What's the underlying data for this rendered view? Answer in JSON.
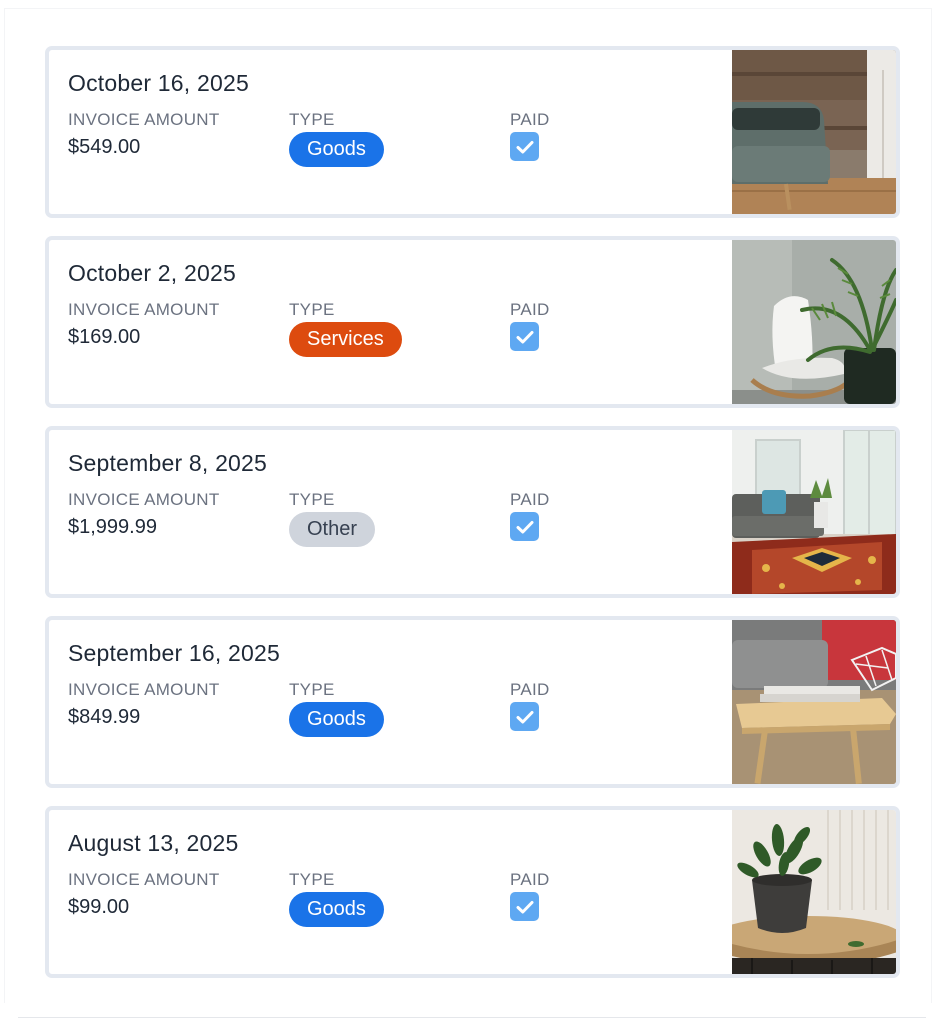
{
  "labels": {
    "amount": "INVOICE AMOUNT",
    "type": "TYPE",
    "paid": "PAID"
  },
  "colors": {
    "goods": "#1a73e8",
    "services": "#dd4b0f",
    "other": "#cfd4dc",
    "checkbox": "#5ea8f2",
    "card_border": "#e3e8f0"
  },
  "invoices": [
    {
      "date": "October 16, 2025",
      "amount": "$549.00",
      "type": "Goods",
      "paid": true,
      "image_icon": "sofa-photo"
    },
    {
      "date": "October 2, 2025",
      "amount": "$169.00",
      "type": "Services",
      "paid": true,
      "image_icon": "chair-plant-photo"
    },
    {
      "date": "September 8, 2025",
      "amount": "$1,999.99",
      "type": "Other",
      "paid": true,
      "image_icon": "living-room-photo"
    },
    {
      "date": "September 16, 2025",
      "amount": "$849.99",
      "type": "Goods",
      "paid": true,
      "image_icon": "coffee-table-photo"
    },
    {
      "date": "August 13, 2025",
      "amount": "$99.00",
      "type": "Goods",
      "paid": true,
      "image_icon": "potted-plant-photo"
    }
  ]
}
